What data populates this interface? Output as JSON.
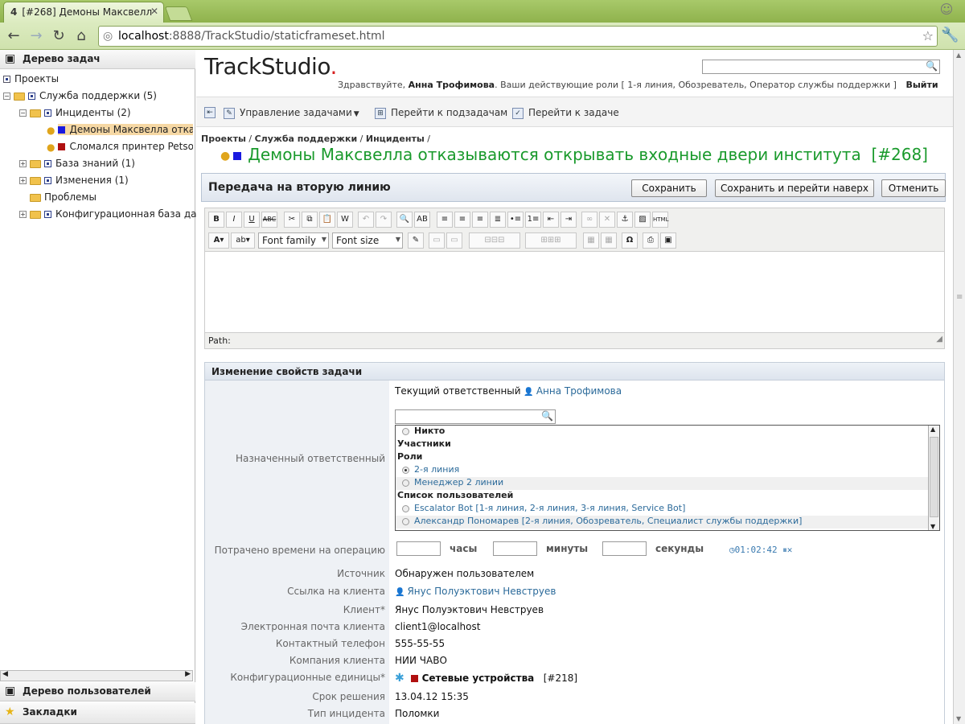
{
  "browser": {
    "tab_title": "[#268] Демоны Максвелл",
    "tab_icon": "4",
    "url_host": "localhost",
    "url_rest": ":8888/TrackStudio/staticframeset.html"
  },
  "left_pane": {
    "tasks_header": "Дерево задач",
    "users_header": "Дерево пользователей",
    "bookmarks_header": "Закладки",
    "tree": [
      {
        "label": "Проекты"
      },
      {
        "label": "Служба поддержки (5)"
      },
      {
        "label": "Инциденты (2)"
      },
      {
        "label": "Демоны Максвелла отказ"
      },
      {
        "label": "Сломался принтер Petson"
      },
      {
        "label": "База знаний (1)"
      },
      {
        "label": "Изменения (1)"
      },
      {
        "label": "Проблемы"
      },
      {
        "label": "Конфигурационная база дан"
      }
    ]
  },
  "header": {
    "logo": "TrackStudio",
    "logo_dot": ".",
    "greeting_prefix": "Здравствуйте,",
    "user_name": "Анна Трофимова",
    "roles_text": ". Ваши действующие роли  [ 1-я линия, Обозреватель, Оператор службы поддержки ]",
    "logout": "Выйти"
  },
  "commands": {
    "manage": "Управление задачами",
    "subtasks": "Перейти к подзадачам",
    "goto": "Перейти к задаче"
  },
  "breadcrumb": [
    "Проекты",
    "Служба поддержки",
    "Инциденты"
  ],
  "task": {
    "title": "Демоны Максвелла отказываются открывать входные двери института",
    "number": "[#268]"
  },
  "form": {
    "title": "Передача на вторую линию",
    "save": "Сохранить",
    "save_up": "Сохранить и перейти наверх",
    "cancel": "Отменить"
  },
  "editor": {
    "font_family": "Font family",
    "font_size": "Font size",
    "path_label": "Path:"
  },
  "props": {
    "header": "Изменение свойств задачи",
    "current_handler_label": "Текущий ответственный",
    "current_handler": "Анна Трофимова",
    "assigned_label": "Назначенный ответственный",
    "user_list": [
      {
        "text": "Никто",
        "type": "radio-bold"
      },
      {
        "text": "Участники",
        "type": "group"
      },
      {
        "text": "Роли",
        "type": "group"
      },
      {
        "text": "2-я линия",
        "type": "radio-link",
        "checked": true
      },
      {
        "text": "Менеджер 2 линии",
        "type": "radio-link"
      },
      {
        "text": "Список пользователей",
        "type": "group"
      },
      {
        "text": "Escalator Bot  [1-я линия, 2-я линия, 3-я линия, Service Bot]",
        "type": "radio-link"
      },
      {
        "text": "Александр Пономарев  [2-я линия, Обозреватель, Специалист службы поддержки]",
        "type": "radio-link"
      }
    ],
    "time_label": "Потрачено времени на операцию",
    "hours": "часы",
    "minutes": "минуты",
    "seconds": "секунды",
    "timer": "01:02:42",
    "fields": [
      {
        "label": "Источник",
        "value": "Обнаружен пользователем"
      },
      {
        "label": "Ссылка на клиента",
        "value": "Янус Полуэктович Невструев"
      },
      {
        "label": "Клиент*",
        "value": "Янус Полуэктович Невструев"
      },
      {
        "label": "Электронная почта клиента",
        "value": "client1@localhost"
      },
      {
        "label": "Контактный телефон",
        "value": "555-55-55"
      },
      {
        "label": "Компания клиента",
        "value": "НИИ ЧАВО"
      },
      {
        "label": "Конфигурационные единицы*",
        "value": "Сетевые устройства",
        "extra": "[#218]"
      },
      {
        "label": "Срок решения",
        "value": "13.04.12 15:35"
      },
      {
        "label": "Тип инцидента",
        "value": "Поломки"
      }
    ]
  },
  "colors": {
    "title_green": "#1a9a2c",
    "link_blue": "#2b6a9a",
    "browser_green": "#a8c96a"
  }
}
